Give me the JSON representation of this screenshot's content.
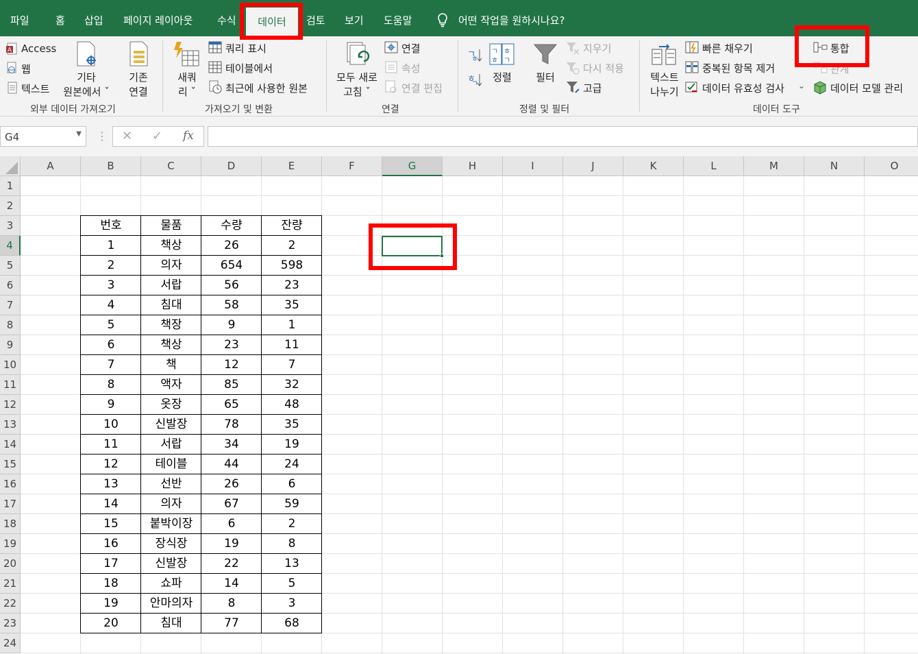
{
  "tabs": [
    "파일",
    "홈",
    "삽입",
    "페이지 레이아웃",
    "수식",
    "데이터",
    "검토",
    "보기",
    "도움말"
  ],
  "tell_me": "어떤 작업을 원하시나요?",
  "ribbon": {
    "get_external": {
      "access": "Access",
      "web": "웹",
      "text": "텍스트",
      "other_sources_1": "기타",
      "other_sources_2": "원본에서 ˇ",
      "existing_1": "기존",
      "existing_2": "연결",
      "group": "외부 데이터 가져오기"
    },
    "get_transform": {
      "new_query_1": "새쿼",
      "new_query_2": "리 ˇ",
      "show_queries": "쿼리 표시",
      "from_table": "테이블에서",
      "recent_sources": "최근에 사용한 원본",
      "group": "가져오기 및 변환"
    },
    "connections": {
      "refresh_1": "모두 새로",
      "refresh_2": "고침 ˇ",
      "connections": "연결",
      "properties": "속성",
      "edit_links": "연결 편집",
      "group": "연결"
    },
    "sort_filter": {
      "sort": "정렬",
      "filter": "필터",
      "clear": "지우기",
      "reapply": "다시 적용",
      "advanced": "고급",
      "group": "정렬 및 필터"
    },
    "data_tools": {
      "text_to_columns_1": "텍스트",
      "text_to_columns_2": "나누기",
      "flash_fill": "빠른 채우기",
      "remove_duplicates": "중복된 항목 제거",
      "data_validation": "데이터 유효성 검사",
      "consolidate": "통합",
      "relationships": "관계",
      "data_model": "데이터 모델 관리",
      "group": "데이터 도구"
    }
  },
  "formula_bar": {
    "name_box": "G4",
    "formula": ""
  },
  "columns": [
    "A",
    "B",
    "C",
    "D",
    "E",
    "F",
    "G",
    "H",
    "I",
    "J",
    "K",
    "L",
    "M",
    "N",
    "O"
  ],
  "rows": [
    "1",
    "2",
    "3",
    "4",
    "5",
    "6",
    "7",
    "8",
    "9",
    "10",
    "11",
    "12",
    "13",
    "14",
    "15",
    "16",
    "17",
    "18",
    "19",
    "20",
    "21",
    "22",
    "23",
    "24"
  ],
  "table": {
    "headers": [
      "번호",
      "물품",
      "수량",
      "잔량"
    ],
    "rows": [
      [
        "1",
        "책상",
        "26",
        "2"
      ],
      [
        "2",
        "의자",
        "654",
        "598"
      ],
      [
        "3",
        "서랍",
        "56",
        "23"
      ],
      [
        "4",
        "침대",
        "58",
        "35"
      ],
      [
        "5",
        "책장",
        "9",
        "1"
      ],
      [
        "6",
        "책상",
        "23",
        "11"
      ],
      [
        "7",
        "책",
        "12",
        "7"
      ],
      [
        "8",
        "액자",
        "85",
        "32"
      ],
      [
        "9",
        "옷장",
        "65",
        "48"
      ],
      [
        "10",
        "신발장",
        "78",
        "35"
      ],
      [
        "11",
        "서랍",
        "34",
        "19"
      ],
      [
        "12",
        "테이블",
        "44",
        "24"
      ],
      [
        "13",
        "선반",
        "26",
        "6"
      ],
      [
        "14",
        "의자",
        "67",
        "59"
      ],
      [
        "15",
        "붙박이장",
        "6",
        "2"
      ],
      [
        "16",
        "장식장",
        "19",
        "8"
      ],
      [
        "17",
        "신발장",
        "22",
        "13"
      ],
      [
        "18",
        "쇼파",
        "14",
        "5"
      ],
      [
        "19",
        "안마의자",
        "8",
        "3"
      ],
      [
        "20",
        "침대",
        "77",
        "68"
      ]
    ]
  },
  "colors": {
    "excel_green": "#217346",
    "highlight_red": "#ff0000"
  }
}
